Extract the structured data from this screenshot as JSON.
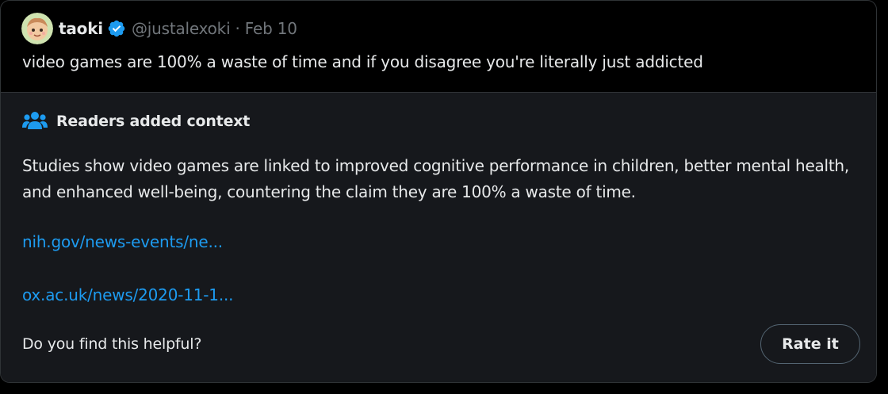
{
  "tweet": {
    "author": {
      "name": "taoki",
      "handle": "@justalexoki",
      "verified": true
    },
    "separator": "·",
    "date": "Feb 10",
    "text": "video games are 100% a waste of time and if you disagree you're literally just addicted"
  },
  "community_note": {
    "title": "Readers added context",
    "body": "Studies show video games are linked to improved cognitive performance in children, better mental health, and enhanced well-being, countering the claim they are 100% a waste of time.",
    "links": [
      "nih.gov/news-events/ne...",
      "ox.ac.uk/news/2020-11-1..."
    ],
    "helpful_question": "Do you find this helpful?",
    "rate_label": "Rate it"
  },
  "colors": {
    "background": "#000000",
    "note_background": "#16181c",
    "text_primary": "#e7e9ea",
    "text_secondary": "#71767b",
    "link": "#1d9bf0",
    "verified_badge": "#1d9bf0"
  },
  "icons": {
    "verified": "verified-badge-icon",
    "community_notes": "people-group-icon"
  }
}
